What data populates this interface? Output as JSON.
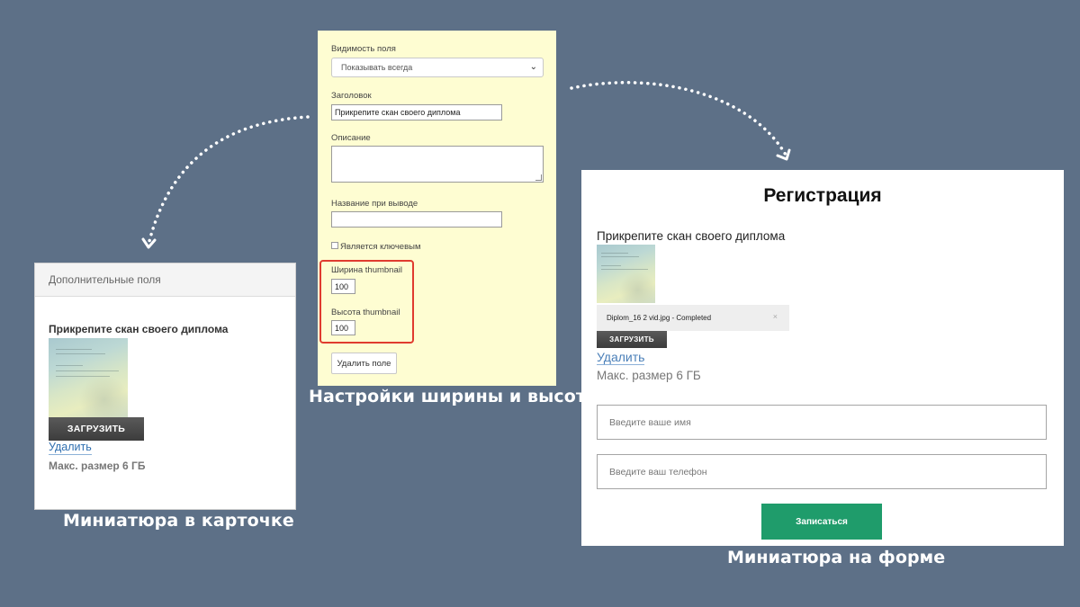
{
  "colors": {
    "background": "#5d7087",
    "settings_panel": "#fefdd2",
    "highlight_box": "#e03b2f",
    "submit_button": "#1f9c6b",
    "link": "#2f6fb0"
  },
  "settings": {
    "visibility_label": "Видимость поля",
    "visibility_value": "Показывать всегда",
    "title_label": "Заголовок",
    "title_value": "Прикрепите скан своего диплома",
    "description_label": "Описание",
    "output_name_label": "Название при выводе",
    "is_key_label": "Является ключевым",
    "thumb_width_label": "Ширина thumbnail",
    "thumb_width_value": "100",
    "thumb_height_label": "Высота thumbnail",
    "thumb_height_value": "100",
    "delete_field_label": "Удалить поле",
    "caption": "Настройки ширины и высоты"
  },
  "card": {
    "header": "Дополнительные поля",
    "field_title": "Прикрепите скан своего диплома",
    "upload_label": "ЗАГРУЗИТЬ",
    "delete_label": "Удалить",
    "max_size": "Макс. размер 6 ГБ",
    "caption": "Миниатюра в карточке"
  },
  "form": {
    "title": "Регистрация",
    "field_title": "Прикрепите скан своего диплома",
    "file_status": "Diplom_16 2 vid.jpg - Completed",
    "close_symbol": "×",
    "upload_label": "ЗАГРУЗИТЬ",
    "delete_label": "Удалить",
    "max_size": "Макс. размер 6 ГБ",
    "name_placeholder": "Введите ваше имя",
    "phone_placeholder": "Введите ваш телефон",
    "submit_label": "Записаться",
    "caption": "Миниатюра на форме"
  },
  "icons": {
    "select_chevron": "chevron-down-icon",
    "textarea_resize": "resize-grip-icon",
    "remove_file": "close-icon",
    "arrows": "dotted-arrow-icon"
  }
}
